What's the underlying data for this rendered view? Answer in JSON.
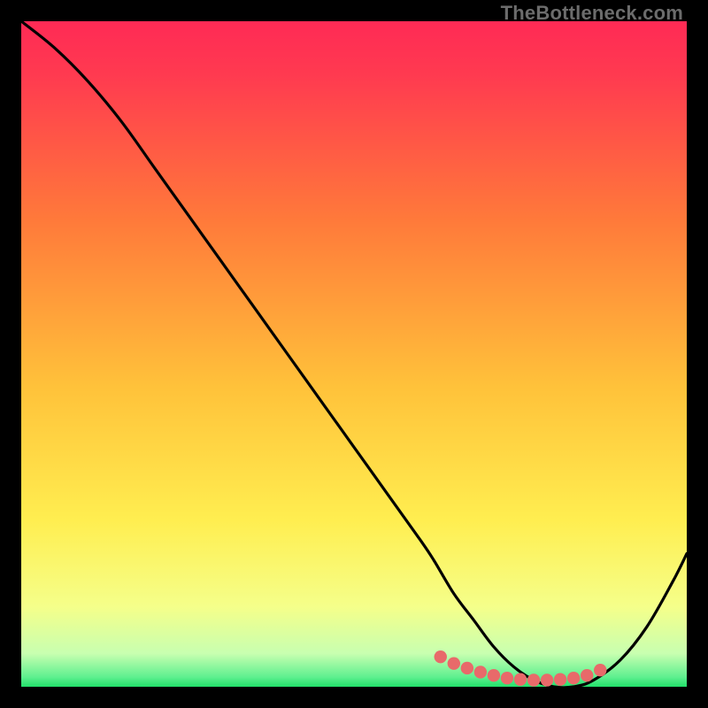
{
  "watermark": "TheBottleneck.com",
  "colors": {
    "top": "#ff2a55",
    "mid1": "#ff7a3a",
    "mid2": "#ffd23a",
    "mid3": "#ffff60",
    "bottom": "#22e06a",
    "curve": "#000000",
    "highlight": "#e86a6a",
    "frame": "#000000"
  },
  "chart_data": {
    "type": "line",
    "title": "",
    "xlabel": "",
    "ylabel": "",
    "xlim": [
      0,
      100
    ],
    "ylim": [
      0,
      100
    ],
    "series": [
      {
        "name": "bottleneck-curve",
        "x": [
          0,
          5,
          10,
          15,
          20,
          25,
          30,
          35,
          40,
          45,
          50,
          55,
          60,
          62,
          65,
          68,
          71,
          74,
          77,
          80,
          83,
          86,
          90,
          94,
          98,
          100
        ],
        "y": [
          100,
          96,
          91,
          85,
          78,
          71,
          64,
          57,
          50,
          43,
          36,
          29,
          22,
          19,
          14,
          10,
          6,
          3,
          1,
          0,
          0,
          1,
          4,
          9,
          16,
          20
        ]
      }
    ],
    "highlight_zone": {
      "name": "optimal-range-dots",
      "x": [
        63,
        65,
        67,
        69,
        71,
        73,
        75,
        77,
        79,
        81,
        83,
        85,
        87
      ],
      "y": [
        4.5,
        3.5,
        2.8,
        2.2,
        1.7,
        1.3,
        1.1,
        1.0,
        1.0,
        1.1,
        1.3,
        1.7,
        2.5
      ]
    }
  }
}
